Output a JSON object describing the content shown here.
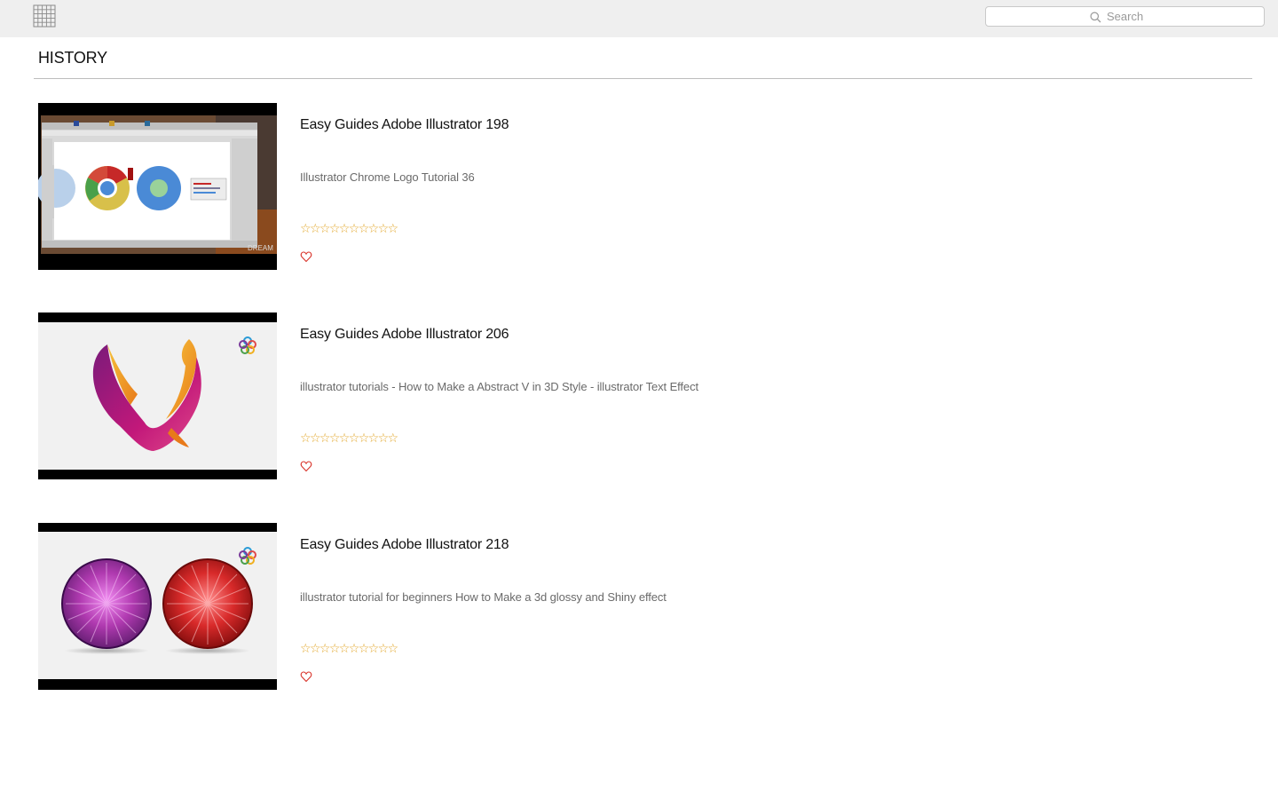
{
  "toolbar": {
    "grid_icon": "grid-view-icon",
    "search": {
      "placeholder": "Search",
      "value": "",
      "icon": "search-icon"
    }
  },
  "section": {
    "title": "HISTORY"
  },
  "colors": {
    "toolbar_bg": "#efefef",
    "star": "#e2a72b",
    "heart": "#d9342b",
    "divider": "#bdbdbd"
  },
  "items": [
    {
      "title": "Easy Guides Adobe Illustrator 198",
      "description": "Illustrator Chrome Logo Tutorial 36",
      "rating_stars": "☆☆☆☆☆☆☆☆☆☆",
      "favorite_icon": "heart-outline-icon"
    },
    {
      "title": "Easy Guides Adobe Illustrator 206",
      "description": "illustrator tutorials - How to Make a Abstract V in 3D Style - illustrator Text Effect",
      "rating_stars": "☆☆☆☆☆☆☆☆☆☆",
      "favorite_icon": "heart-outline-icon"
    },
    {
      "title": "Easy Guides Adobe Illustrator 218",
      "description": "illustrator tutorial for beginners  How to Make a 3d glossy and Shiny effect",
      "rating_stars": "☆☆☆☆☆☆☆☆☆☆",
      "favorite_icon": "heart-outline-icon"
    }
  ]
}
